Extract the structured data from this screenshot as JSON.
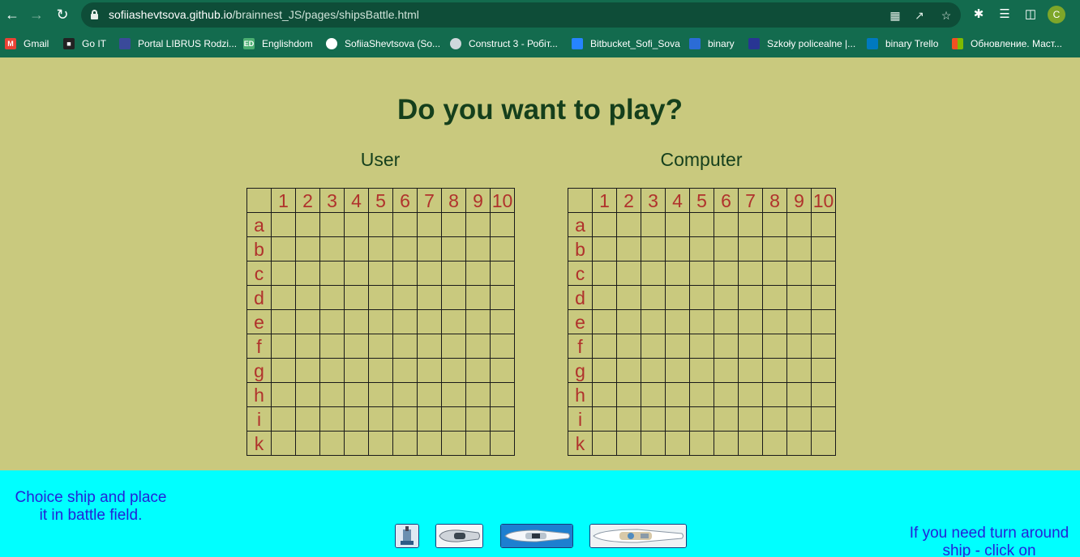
{
  "browser": {
    "url_host": "sofiiashevtsova.github.io",
    "url_path": "/brainnest_JS/pages/shipsBattle.html",
    "profile_initial": "C"
  },
  "bookmarks": [
    {
      "label": "Gmail",
      "icon": "gmail-icon",
      "color": "#ea4335"
    },
    {
      "label": "Go IT",
      "icon": "goit-icon",
      "color": "#222222"
    },
    {
      "label": "Portal LIBRUS Rodzi...",
      "icon": "librus-icon",
      "color": "#3a4a9a"
    },
    {
      "label": "Englishdom",
      "icon": "englishdom-icon",
      "color": "#4caf72"
    },
    {
      "label": "SofiiaShevtsova (So...",
      "icon": "github-icon",
      "color": "#ffffff"
    },
    {
      "label": "Construct 3 - Робіт...",
      "icon": "construct-icon",
      "color": "#cfd8dc"
    },
    {
      "label": "Bitbucket_Sofi_Sova",
      "icon": "bitbucket-icon",
      "color": "#2684ff"
    },
    {
      "label": "binary",
      "icon": "binary-icon",
      "color": "#2b6cd6"
    },
    {
      "label": "Szkoły policealne |...",
      "icon": "school-icon",
      "color": "#283593"
    },
    {
      "label": "binary Trello",
      "icon": "trello-icon",
      "color": "#0079bf"
    },
    {
      "label": "Обновление. Маст...",
      "icon": "windows-icon",
      "color": "#f25022"
    }
  ],
  "page": {
    "title": "Do you want to play?",
    "user_label": "User",
    "computer_label": "Computer",
    "columns": [
      "1",
      "2",
      "3",
      "4",
      "5",
      "6",
      "7",
      "8",
      "9",
      "10"
    ],
    "rows": [
      "a",
      "b",
      "c",
      "d",
      "e",
      "f",
      "g",
      "h",
      "i",
      "k"
    ]
  },
  "bottom": {
    "hint_left": "Choice ship and place it in battle field.",
    "hint_right": "If you need turn around ship - click on"
  },
  "ships": [
    {
      "name": "ship-1-deck",
      "icon": "small-boat-icon"
    },
    {
      "name": "ship-2-deck",
      "icon": "speedboat-icon"
    },
    {
      "name": "ship-3-deck",
      "icon": "motor-yacht-icon"
    },
    {
      "name": "ship-4-deck",
      "icon": "large-yacht-icon"
    }
  ],
  "colors": {
    "page_bg": "#c9c97e",
    "chrome": "#136b4e",
    "title": "#153f1c",
    "grid_label": "#b0322c",
    "bottom_bg": "#00ffff",
    "hint_text": "#2323d9"
  }
}
